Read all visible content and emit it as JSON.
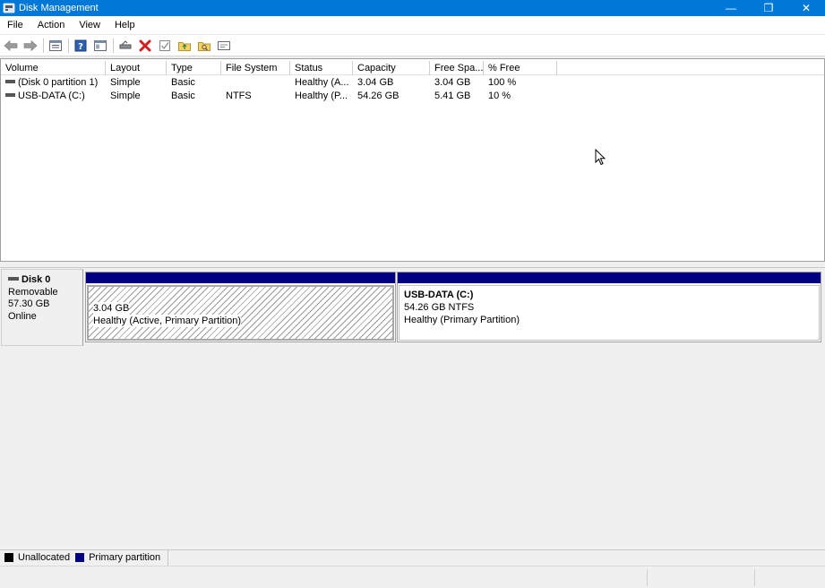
{
  "window": {
    "title": "Disk Management",
    "min_glyph": "—",
    "max_glyph": "❐",
    "close_glyph": "✕"
  },
  "menu": {
    "items": [
      "File",
      "Action",
      "View",
      "Help"
    ]
  },
  "toolbar": {
    "buttons": [
      "back-arrow-icon",
      "forward-arrow-icon",
      "properties-list-icon",
      "help-icon",
      "console-tree-icon",
      "connect-drive-icon",
      "delete-icon",
      "check-icon",
      "folder-up-icon",
      "folder-search-icon",
      "drive-info-icon"
    ],
    "delete_color": "#d11f1f"
  },
  "volume_list": {
    "columns": [
      "Volume",
      "Layout",
      "Type",
      "File System",
      "Status",
      "Capacity",
      "Free Spa...",
      "% Free"
    ],
    "rows": [
      {
        "volume": "(Disk 0 partition 1)",
        "layout": "Simple",
        "type": "Basic",
        "fs": "",
        "status": "Healthy (A...",
        "capacity": "3.04 GB",
        "free": "3.04 GB",
        "pct": "100 %"
      },
      {
        "volume": "USB-DATA (C:)",
        "layout": "Simple",
        "type": "Basic",
        "fs": "NTFS",
        "status": "Healthy (P...",
        "capacity": "54.26 GB",
        "free": "5.41 GB",
        "pct": "10 %"
      }
    ]
  },
  "disk": {
    "name": "Disk 0",
    "type": "Removable",
    "size": "57.30 GB",
    "state": "Online",
    "partitions": [
      {
        "name": "",
        "size": "3.04 GB",
        "status": "Healthy (Active, Primary Partition)"
      },
      {
        "name": "USB-DATA  (C:)",
        "size": "54.26 GB NTFS",
        "status": "Healthy (Primary Partition)"
      }
    ]
  },
  "legend": {
    "items": [
      {
        "label": "Unallocated",
        "color": "#000000"
      },
      {
        "label": "Primary partition",
        "color": "#000080"
      }
    ]
  },
  "colors": {
    "titlebar": "#0078d7",
    "primary_partition": "#000080"
  }
}
